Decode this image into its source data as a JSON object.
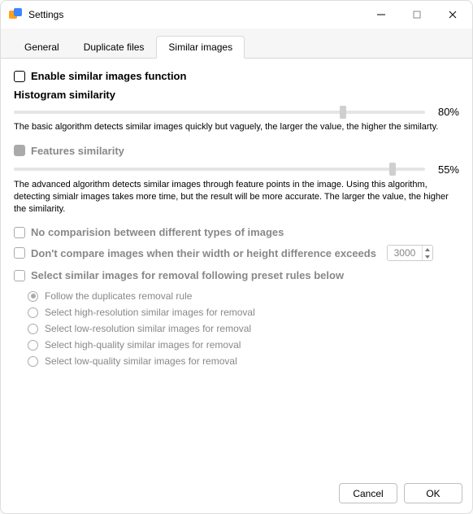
{
  "window": {
    "title": "Settings"
  },
  "tabs": [
    {
      "label": "General"
    },
    {
      "label": "Duplicate files"
    },
    {
      "label": "Similar images"
    }
  ],
  "active_tab": 2,
  "enable": {
    "label": "Enable similar images function"
  },
  "histogram": {
    "title": "Histogram similarity",
    "value_label": "80%",
    "percent": 80,
    "desc": "The basic algorithm detects similar images quickly but vaguely, the larger the value, the higher the similarty."
  },
  "features": {
    "title": "Features similarity",
    "value_label": "55%",
    "percent": 92,
    "desc": "The advanced algorithm detects similar images through feature points in the image. Using this algorithm, detecting simialr images takes more time, but the result will be more accurate. The larger the value, the higher the similarity."
  },
  "no_compare_types": {
    "label": "No comparision between different types of images"
  },
  "dim_diff": {
    "label": "Don't compare images when their width or height difference exceeds",
    "value": "3000"
  },
  "preset_header": {
    "label": "Select similar images for removal following preset rules below"
  },
  "radios": [
    {
      "label": "Follow the duplicates removal rule"
    },
    {
      "label": "Select high-resolution similar images for removal"
    },
    {
      "label": "Select low-resolution similar images for removal"
    },
    {
      "label": "Select high-quality similar images for removal"
    },
    {
      "label": "Select low-quality similar images for removal"
    }
  ],
  "selected_radio": 0,
  "buttons": {
    "cancel": "Cancel",
    "ok": "OK"
  }
}
